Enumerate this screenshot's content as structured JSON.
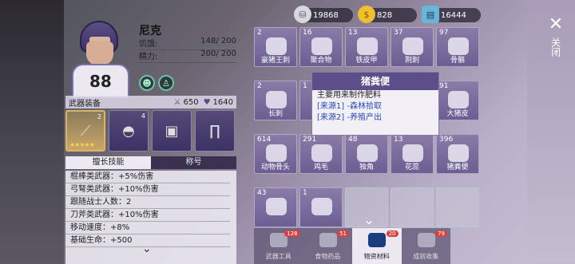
{
  "currencies": [
    {
      "icon": "coins-stack-icon",
      "value": "19868"
    },
    {
      "icon": "gold-coin-icon",
      "value": "828"
    },
    {
      "icon": "ticket-icon",
      "value": "16444"
    }
  ],
  "character": {
    "name": "尼克",
    "hunger_label": "饥饿:",
    "hunger_value": "148/ 200",
    "energy_label": "精力:",
    "energy_value": "200/ 200",
    "jersey_number": "88"
  },
  "equipment": {
    "label": "武器装备",
    "attack": "650",
    "health": "1640",
    "slots": [
      {
        "name": "weapon",
        "badge": "2",
        "stars": "★★★★★"
      },
      {
        "name": "helmet",
        "badge": "4"
      },
      {
        "name": "jersey",
        "badge": ""
      },
      {
        "name": "pants",
        "badge": ""
      }
    ]
  },
  "tabs": {
    "skills": "擅长技能",
    "title": "称号"
  },
  "skills": [
    "棍棒类武器：+5%伤害",
    "弓弩类武器：+10%伤害",
    "跟随战士人数：2",
    "刀斧类武器：+10%伤害",
    "移动速度：+8%",
    "基础生命：+500"
  ],
  "inventory": [
    {
      "count": "2",
      "name": "豪猪王刺"
    },
    {
      "count": "16",
      "name": "聚合物"
    },
    {
      "count": "13",
      "name": "铁皮甲"
    },
    {
      "count": "37",
      "name": "荆刺"
    },
    {
      "count": "97",
      "name": "骨骼"
    },
    {
      "count": "2",
      "name": "长刺"
    },
    {
      "count": "1",
      "name": ""
    },
    {
      "count": "",
      "name": ""
    },
    {
      "count": "",
      "name": ""
    },
    {
      "count": "91",
      "name": "大猪皮"
    },
    {
      "count": "614",
      "name": "动物骨头"
    },
    {
      "count": "291",
      "name": "鸡毛"
    },
    {
      "count": "48",
      "name": "独角"
    },
    {
      "count": "13",
      "name": "花蕊"
    },
    {
      "count": "396",
      "name": "猪粪便"
    },
    {
      "count": "43",
      "name": ""
    },
    {
      "count": "1",
      "name": ""
    }
  ],
  "tooltip": {
    "title": "猪粪便",
    "desc": "主要用来制作肥料",
    "source1": "[来源1] -森林拾取",
    "source2": "[来源2] -养殖产出"
  },
  "categories": [
    {
      "label": "武器工具",
      "badge": "128"
    },
    {
      "label": "食物药品",
      "badge": "51"
    },
    {
      "label": "物资材料",
      "badge": "20"
    },
    {
      "label": "成就收集",
      "badge": "79"
    }
  ],
  "close_label": "关闭"
}
